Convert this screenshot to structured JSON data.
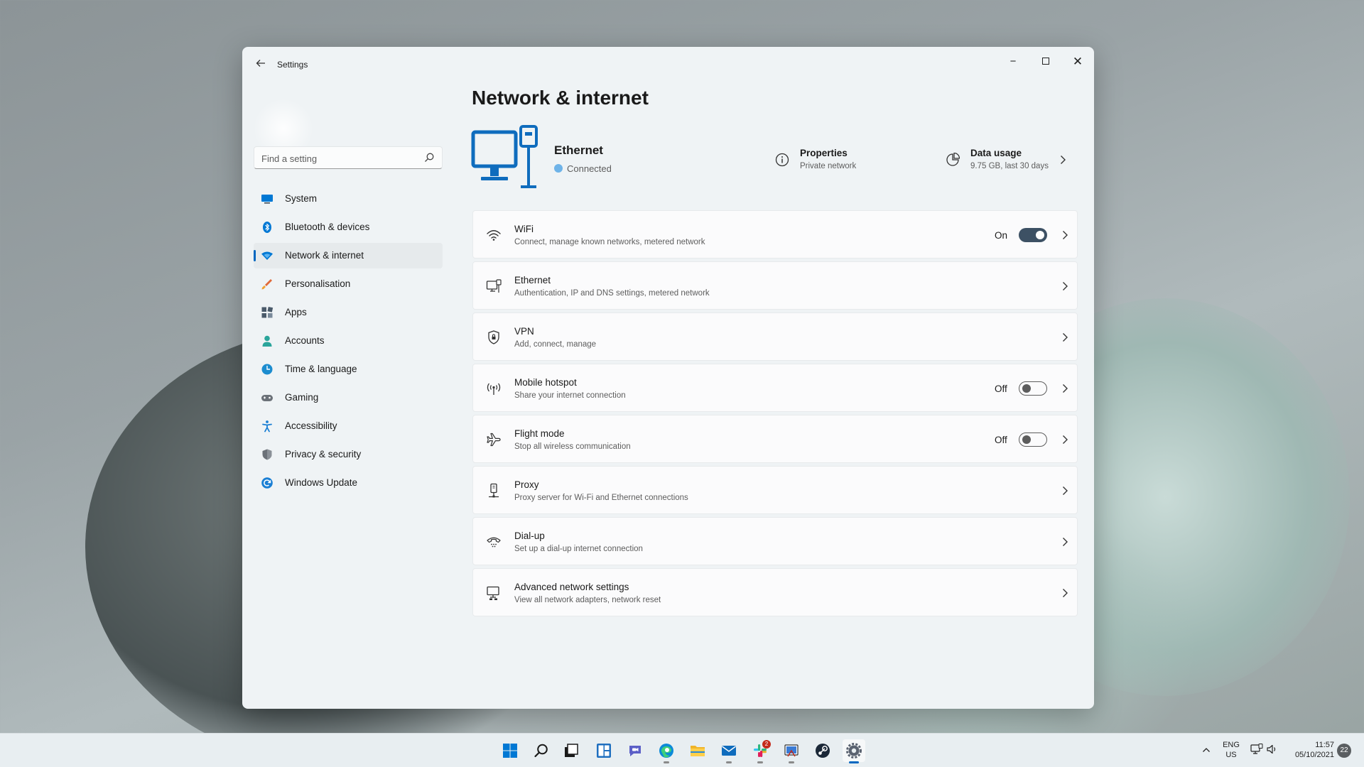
{
  "window": {
    "app_title": "Settings",
    "controls": {
      "minimize": "−",
      "close": "✕"
    }
  },
  "sidebar": {
    "search_placeholder": "Find a setting",
    "items": [
      {
        "label": "System",
        "icon": "monitor-icon",
        "color": "#0078d4"
      },
      {
        "label": "Bluetooth & devices",
        "icon": "bluetooth-icon",
        "color": "#0078d4"
      },
      {
        "label": "Network & internet",
        "icon": "wifi-diamond-icon",
        "color": "#0078d4",
        "active": true
      },
      {
        "label": "Personalisation",
        "icon": "brush-icon",
        "color": "#e06a3a"
      },
      {
        "label": "Apps",
        "icon": "apps-icon",
        "color": "#4a5a6a"
      },
      {
        "label": "Accounts",
        "icon": "person-icon",
        "color": "#2aa59b"
      },
      {
        "label": "Time & language",
        "icon": "globe-clock-icon",
        "color": "#1c8ccf"
      },
      {
        "label": "Gaming",
        "icon": "gamepad-icon",
        "color": "#6b7178"
      },
      {
        "label": "Accessibility",
        "icon": "accessibility-icon",
        "color": "#1a7fd4"
      },
      {
        "label": "Privacy & security",
        "icon": "shield-icon",
        "color": "#6b7178"
      },
      {
        "label": "Windows Update",
        "icon": "update-icon",
        "color": "#1a7fd4"
      }
    ]
  },
  "main": {
    "page_title": "Network & internet",
    "hero": {
      "name": "Ethernet",
      "status": "Connected",
      "properties_title": "Properties",
      "properties_sub": "Private network",
      "data_title": "Data usage",
      "data_sub": "9.75 GB, last 30 days"
    },
    "cards": [
      {
        "title": "WiFi",
        "subtitle": "Connect, manage known networks, metered network",
        "state": "On",
        "toggle": "on",
        "icon": "wifi-icon"
      },
      {
        "title": "Ethernet",
        "subtitle": "Authentication, IP and DNS settings, metered network",
        "icon": "ethernet-icon"
      },
      {
        "title": "VPN",
        "subtitle": "Add, connect, manage",
        "icon": "vpn-shield-icon"
      },
      {
        "title": "Mobile hotspot",
        "subtitle": "Share your internet connection",
        "state": "Off",
        "toggle": "off",
        "icon": "hotspot-icon"
      },
      {
        "title": "Flight mode",
        "subtitle": "Stop all wireless communication",
        "state": "Off",
        "toggle": "off",
        "icon": "airplane-icon"
      },
      {
        "title": "Proxy",
        "subtitle": "Proxy server for Wi-Fi and Ethernet connections",
        "icon": "proxy-icon"
      },
      {
        "title": "Dial-up",
        "subtitle": "Set up a dial-up internet connection",
        "icon": "dialup-icon"
      },
      {
        "title": "Advanced network settings",
        "subtitle": "View all network adapters, network reset",
        "icon": "advanced-network-icon"
      }
    ]
  },
  "taskbar": {
    "apps": [
      "start-icon",
      "search-icon",
      "task-view-icon",
      "widgets-icon",
      "teams-chat-icon",
      "edge-icon",
      "file-explorer-icon",
      "mail-icon",
      "slack-icon",
      "snipping-tool-icon",
      "steam-icon",
      "settings-icon"
    ],
    "slack_badge": "2",
    "lang_line1": "ENG",
    "lang_line2": "US",
    "time": "11:57",
    "date": "05/10/2021",
    "notification_count": "22"
  }
}
